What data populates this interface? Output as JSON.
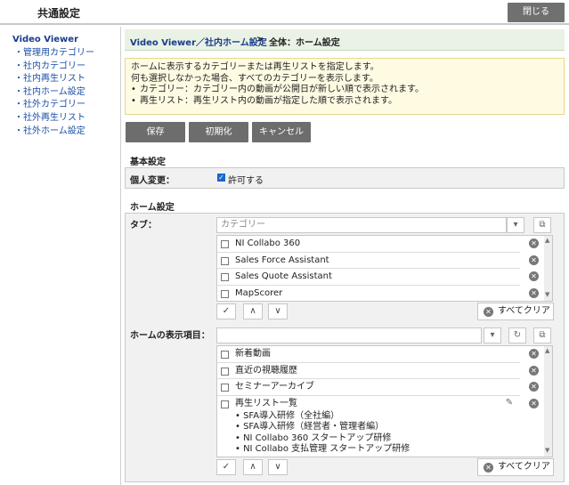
{
  "topbar": {
    "title": "共通設定",
    "close_label": "閉じる"
  },
  "sidebar": {
    "heading": "Video Viewer",
    "items": [
      {
        "label": "管理用カテゴリー"
      },
      {
        "label": "社内カテゴリー"
      },
      {
        "label": "社内再生リスト"
      },
      {
        "label": "社内ホーム設定"
      },
      {
        "label": "社外カテゴリー"
      },
      {
        "label": "社外再生リスト"
      },
      {
        "label": "社外ホーム設定"
      }
    ]
  },
  "breadcrumb": {
    "link": "Video Viewer／社内ホーム設定",
    "separator": ">",
    "current": "全体：ホーム設定"
  },
  "notice": {
    "line1": "ホームに表示するカテゴリーまたは再生リストを指定します。",
    "line2": "何も選択しなかった場合、すべてのカテゴリーを表示します。",
    "bullet1": "カテゴリー：カテゴリー内の動画が公開日が新しい順で表示されます。",
    "bullet2": "再生リスト：再生リスト内の動画が指定した順で表示されます。"
  },
  "actions": {
    "save": "保存",
    "reset": "初期化",
    "cancel": "キャンセル"
  },
  "basic": {
    "title": "基本設定",
    "personal_label": "個人変更：",
    "allow_label": "許可する",
    "allow_checked": true
  },
  "home": {
    "title": "ホーム設定",
    "tab_label": "タブ：",
    "tab_placeholder": "カテゴリー",
    "tab_items": [
      {
        "label": "NI Collabo 360"
      },
      {
        "label": "Sales Force Assistant"
      },
      {
        "label": "Sales Quote Assistant"
      },
      {
        "label": "MapScorer"
      }
    ],
    "display_label": "ホームの表示項目：",
    "display_items": [
      {
        "label": "新着動画"
      },
      {
        "label": "直近の視聴履歴"
      },
      {
        "label": "セミナーアーカイブ"
      },
      {
        "label": "再生リスト一覧"
      }
    ],
    "playlist_children": [
      "SFA導入研修（全社編）",
      "SFA導入研修（経営者・管理者編）",
      "NI Collabo 360 スタートアップ研修",
      "NI Collabo 支払管理 スタートアップ研修"
    ],
    "clear_all": "すべてクリア",
    "check_glyph": "✓",
    "up_glyph": "∧",
    "down_glyph": "∨"
  }
}
